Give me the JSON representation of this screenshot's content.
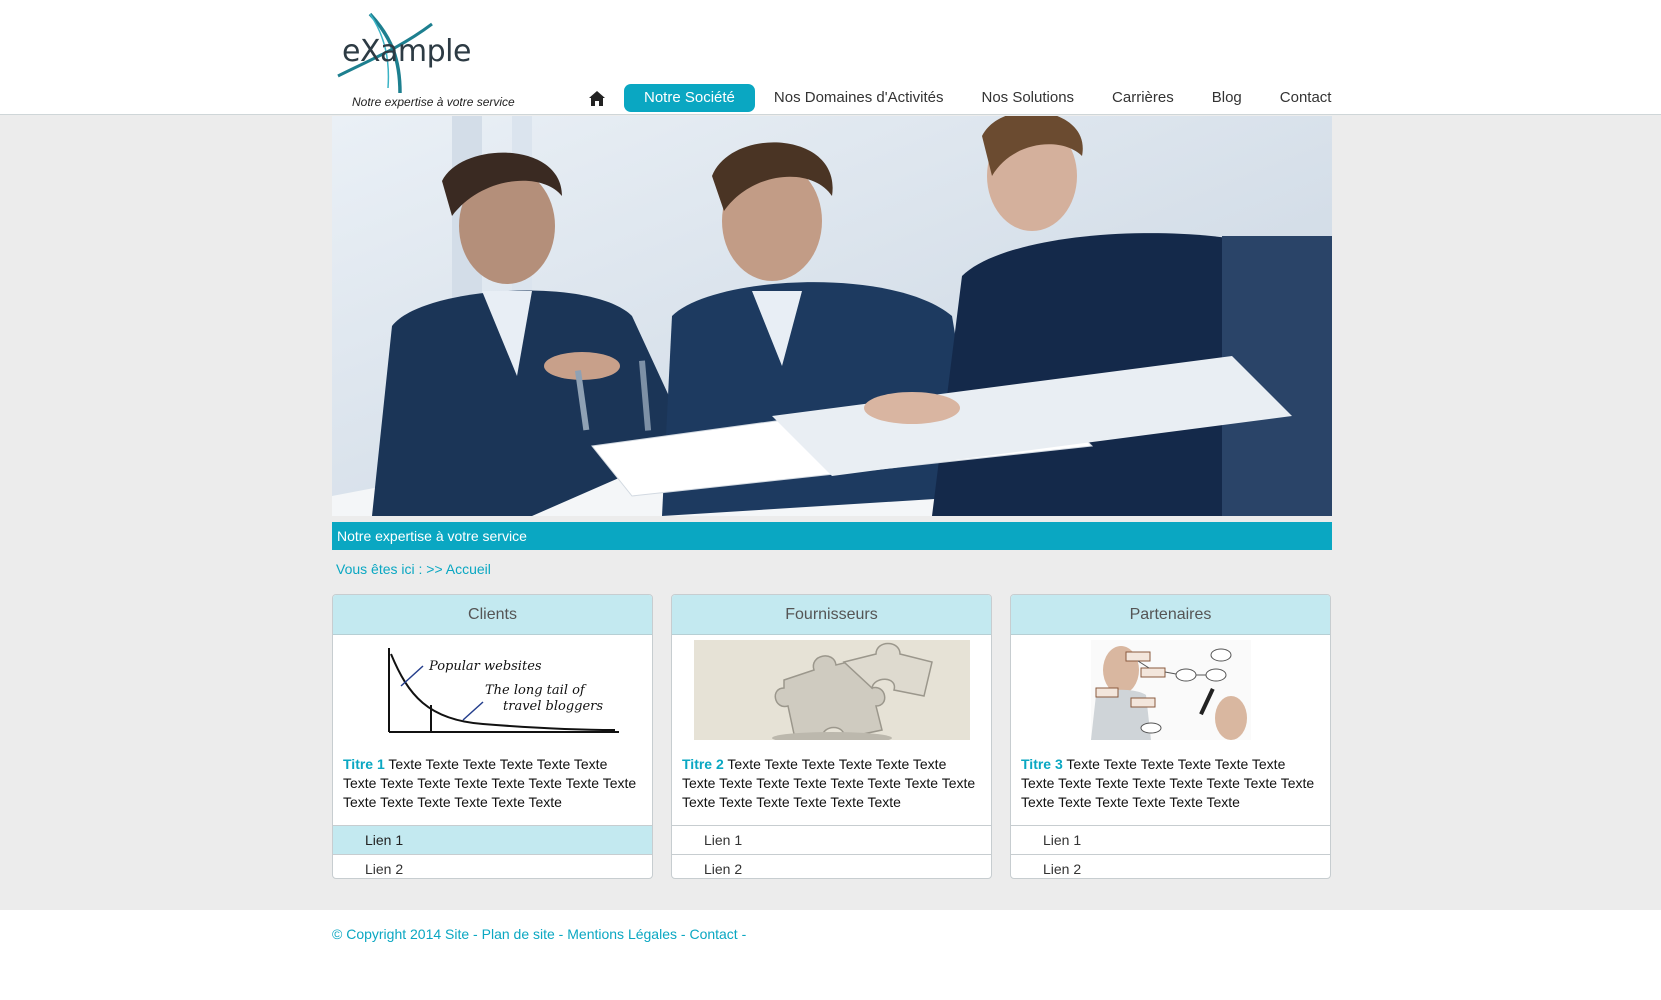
{
  "header": {
    "logo_text": "eXample",
    "tagline": "Notre expertise à votre service",
    "nav": {
      "home_icon": "home-icon",
      "items": [
        {
          "label": "Notre Société",
          "active": true
        },
        {
          "label": "Nos Domaines d'Activités",
          "active": false
        },
        {
          "label": "Nos Solutions",
          "active": false
        },
        {
          "label": "Carrières",
          "active": false
        },
        {
          "label": "Blog",
          "active": false
        },
        {
          "label": "Contact",
          "active": false
        }
      ]
    }
  },
  "banner": {
    "caption": "Notre expertise à votre service"
  },
  "breadcrumb": {
    "prefix": "Vous êtes ici : >> ",
    "current": "Accueil"
  },
  "cards": [
    {
      "header": "Clients",
      "image_text": [
        "Popular websites",
        "The long tail of",
        "travel bloggers"
      ],
      "title": "Titre 1",
      "text": " Texte Texte Texte Texte Texte Texte Texte Texte Texte Texte Texte Texte Texte Texte Texte Texte Texte Texte Texte Texte",
      "links": [
        "Lien 1",
        "Lien 2"
      ]
    },
    {
      "header": "Fournisseurs",
      "title": "Titre 2",
      "text": " Texte Texte Texte Texte Texte Texte Texte Texte Texte Texte Texte Texte Texte Texte Texte Texte Texte Texte Texte Texte",
      "links": [
        "Lien 1",
        "Lien 2"
      ]
    },
    {
      "header": "Partenaires",
      "title": "Titre 3",
      "text": " Texte Texte Texte Texte Texte Texte Texte Texte Texte Texte Texte Texte Texte Texte Texte Texte Texte Texte Texte Texte",
      "links": [
        "Lien 1",
        "Lien 2"
      ]
    }
  ],
  "footer": {
    "copyright": "© Copyright 2014 Site",
    "links": [
      "Plan de site",
      "Mentions Légales",
      "Contact"
    ]
  },
  "colors": {
    "accent": "#0aa7c2",
    "card_header_bg": "#c3e9f0",
    "page_bg": "#ececec"
  }
}
